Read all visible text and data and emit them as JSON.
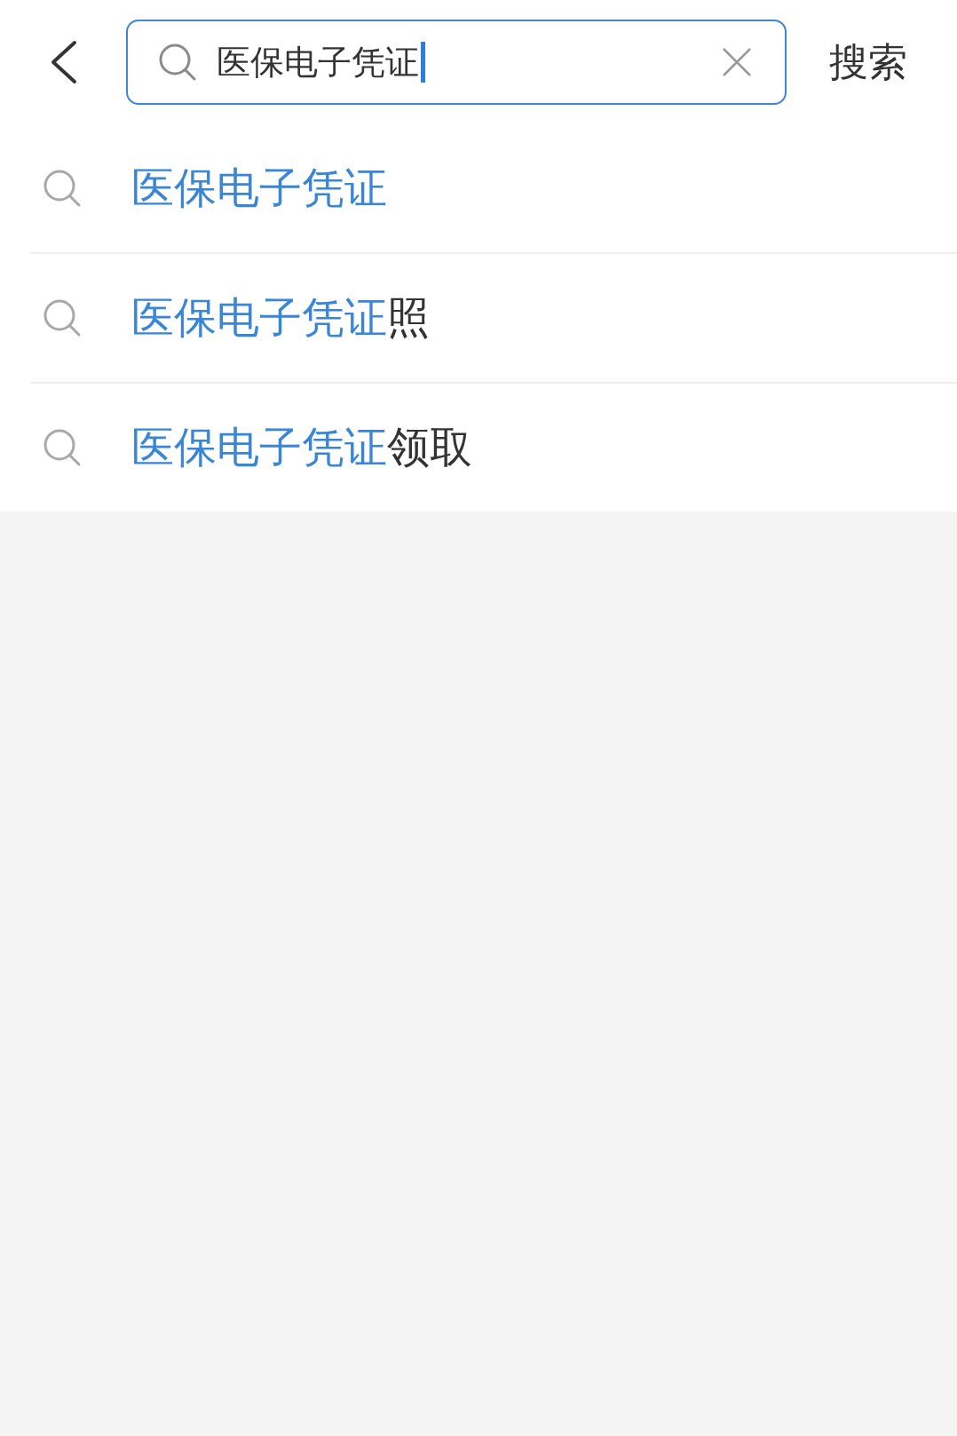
{
  "search_field": {
    "value": "医保电子凭证",
    "focused": true
  },
  "search_button": "搜索",
  "suggestions": [
    {
      "match": "医保电子凭证"
    },
    {
      "match": "医保电子凭证",
      "rest": "照"
    },
    {
      "match": "医保电子凭证",
      "rest": "领取"
    }
  ]
}
